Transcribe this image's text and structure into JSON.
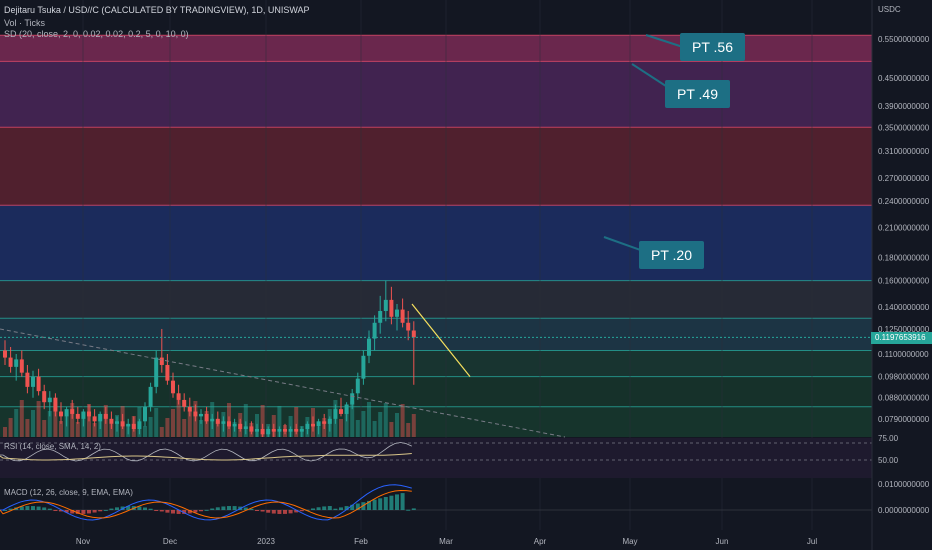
{
  "header": {
    "title": "Dejitaru Tsuka / USD//C (CALCULATED BY TRADINGVIEW), 1D, UNISWAP",
    "volume": "Vol · Ticks",
    "sd": "SD (20, close, 2, 0, 0.02, 0.02, 0.2, 5, 0, 10, 0)"
  },
  "axis_unit": "USDC",
  "current_price": "0.1197653916",
  "targets": [
    {
      "label": "PT .56"
    },
    {
      "label": "PT .49"
    },
    {
      "label": "PT .20"
    }
  ],
  "rsi": {
    "label": "RSI (14, close, SMA, 14, 2)",
    "ticks": [
      "75.00",
      "50.00"
    ]
  },
  "macd": {
    "label": "MACD (12, 26, close, 9, EMA, EMA)",
    "ticks": [
      "0.0100000000",
      "0.0000000000"
    ]
  },
  "colors": {
    "up": "#26a69a",
    "down": "#ef5350",
    "accent": "#1d6f84",
    "background": "#131722"
  },
  "chart_data": {
    "type": "candlestick",
    "price_axis": {
      "scale": "log",
      "ticks": [
        0.55,
        0.45,
        0.39,
        0.35,
        0.31,
        0.27,
        0.24,
        0.21,
        0.18,
        0.16,
        0.14,
        0.125,
        0.11,
        0.098,
        0.088,
        0.079
      ],
      "tick_labels": [
        "0.5500000000",
        "0.4500000000",
        "0.3900000000",
        "0.3500000000",
        "0.3100000000",
        "0.2700000000",
        "0.2400000000",
        "0.2100000000",
        "0.1800000000",
        "0.1600000000",
        "0.1400000000",
        "0.1250000000",
        "0.1100000000",
        "0.0980000000",
        "0.0880000000",
        "0.0790000000"
      ],
      "range": [
        0.072,
        0.62
      ]
    },
    "time_axis": {
      "labels": [
        "Nov",
        "Dec",
        "2023",
        "Feb",
        "Mar",
        "Apr",
        "May",
        "Jun",
        "Jul"
      ]
    },
    "zones": [
      {
        "from": 0.49,
        "to": 0.56,
        "color": "#7a2a55"
      },
      {
        "from": 0.35,
        "to": 0.49,
        "color": "#4a2658"
      },
      {
        "from": 0.235,
        "to": 0.35,
        "color": "#5c2230"
      },
      {
        "from": 0.16,
        "to": 0.235,
        "color": "#1d2f66"
      },
      {
        "from": 0.132,
        "to": 0.16,
        "color": "#2a2e39"
      },
      {
        "from": 0.112,
        "to": 0.132,
        "color": "#1e3a4a"
      },
      {
        "from": 0.098,
        "to": 0.112,
        "color": "#1a3a32"
      },
      {
        "from": 0.084,
        "to": 0.098,
        "color": "#17362c"
      },
      {
        "from": 0.072,
        "to": 0.084,
        "color": "#183a2e"
      }
    ],
    "candles": [
      [
        0.112,
        0.118,
        0.104,
        0.108
      ],
      [
        0.108,
        0.114,
        0.1,
        0.103
      ],
      [
        0.103,
        0.11,
        0.096,
        0.107
      ],
      [
        0.107,
        0.112,
        0.098,
        0.1
      ],
      [
        0.1,
        0.104,
        0.09,
        0.093
      ],
      [
        0.093,
        0.101,
        0.088,
        0.098
      ],
      [
        0.098,
        0.102,
        0.089,
        0.091
      ],
      [
        0.091,
        0.094,
        0.083,
        0.086
      ],
      [
        0.086,
        0.091,
        0.08,
        0.088
      ],
      [
        0.088,
        0.09,
        0.08,
        0.082
      ],
      [
        0.082,
        0.086,
        0.077,
        0.08
      ],
      [
        0.08,
        0.084,
        0.076,
        0.083
      ],
      [
        0.083,
        0.087,
        0.079,
        0.081
      ],
      [
        0.081,
        0.084,
        0.077,
        0.079
      ],
      [
        0.079,
        0.083,
        0.076,
        0.082
      ],
      [
        0.082,
        0.085,
        0.078,
        0.08
      ],
      [
        0.08,
        0.083,
        0.076,
        0.078
      ],
      [
        0.078,
        0.082,
        0.075,
        0.081
      ],
      [
        0.081,
        0.084,
        0.077,
        0.079
      ],
      [
        0.079,
        0.082,
        0.075,
        0.077
      ],
      [
        0.077,
        0.08,
        0.074,
        0.078
      ],
      [
        0.078,
        0.081,
        0.075,
        0.076
      ],
      [
        0.076,
        0.079,
        0.073,
        0.077
      ],
      [
        0.077,
        0.08,
        0.074,
        0.075
      ],
      [
        0.075,
        0.079,
        0.073,
        0.078
      ],
      [
        0.078,
        0.086,
        0.076,
        0.084
      ],
      [
        0.084,
        0.095,
        0.082,
        0.093
      ],
      [
        0.093,
        0.112,
        0.09,
        0.108
      ],
      [
        0.108,
        0.125,
        0.1,
        0.104
      ],
      [
        0.104,
        0.11,
        0.094,
        0.096
      ],
      [
        0.096,
        0.1,
        0.088,
        0.09
      ],
      [
        0.09,
        0.094,
        0.085,
        0.087
      ],
      [
        0.087,
        0.09,
        0.082,
        0.084
      ],
      [
        0.084,
        0.088,
        0.08,
        0.082
      ],
      [
        0.082,
        0.085,
        0.078,
        0.08
      ],
      [
        0.08,
        0.083,
        0.077,
        0.081
      ],
      [
        0.081,
        0.084,
        0.077,
        0.078
      ],
      [
        0.078,
        0.081,
        0.075,
        0.079
      ],
      [
        0.079,
        0.082,
        0.076,
        0.077
      ],
      [
        0.077,
        0.08,
        0.074,
        0.078
      ],
      [
        0.078,
        0.08,
        0.075,
        0.076
      ],
      [
        0.076,
        0.079,
        0.074,
        0.077
      ],
      [
        0.077,
        0.079,
        0.074,
        0.075
      ],
      [
        0.075,
        0.078,
        0.073,
        0.076
      ],
      [
        0.076,
        0.078,
        0.073,
        0.074
      ],
      [
        0.074,
        0.077,
        0.072,
        0.075
      ],
      [
        0.075,
        0.077,
        0.072,
        0.073
      ],
      [
        0.073,
        0.076,
        0.072,
        0.075
      ],
      [
        0.075,
        0.077,
        0.072,
        0.074
      ],
      [
        0.074,
        0.076,
        0.072,
        0.075
      ],
      [
        0.075,
        0.077,
        0.073,
        0.074
      ],
      [
        0.074,
        0.076,
        0.072,
        0.075
      ],
      [
        0.075,
        0.077,
        0.073,
        0.074
      ],
      [
        0.074,
        0.076,
        0.072,
        0.075
      ],
      [
        0.075,
        0.078,
        0.073,
        0.077
      ],
      [
        0.077,
        0.08,
        0.074,
        0.076
      ],
      [
        0.076,
        0.079,
        0.073,
        0.078
      ],
      [
        0.078,
        0.081,
        0.075,
        0.077
      ],
      [
        0.077,
        0.08,
        0.074,
        0.079
      ],
      [
        0.079,
        0.085,
        0.077,
        0.083
      ],
      [
        0.083,
        0.088,
        0.08,
        0.081
      ],
      [
        0.081,
        0.086,
        0.078,
        0.085
      ],
      [
        0.085,
        0.092,
        0.083,
        0.09
      ],
      [
        0.09,
        0.1,
        0.087,
        0.097
      ],
      [
        0.097,
        0.112,
        0.094,
        0.109
      ],
      [
        0.109,
        0.124,
        0.105,
        0.119
      ],
      [
        0.119,
        0.134,
        0.112,
        0.129
      ],
      [
        0.129,
        0.148,
        0.122,
        0.137
      ],
      [
        0.137,
        0.16,
        0.13,
        0.145
      ],
      [
        0.145,
        0.155,
        0.128,
        0.133
      ],
      [
        0.133,
        0.142,
        0.124,
        0.138
      ],
      [
        0.138,
        0.146,
        0.126,
        0.129
      ],
      [
        0.129,
        0.137,
        0.118,
        0.124
      ],
      [
        0.124,
        0.13,
        0.094,
        0.1197653916
      ]
    ],
    "resistance_line": {
      "from": [
        0.142,
        0.142
      ],
      "to": [
        0.098,
        0.098
      ]
    }
  }
}
